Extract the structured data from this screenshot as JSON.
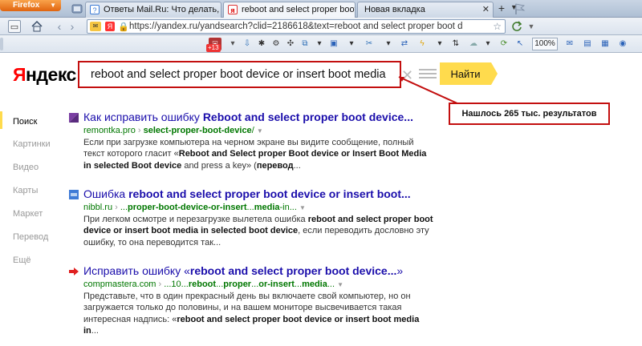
{
  "browser": {
    "app_button": "Firefox",
    "tabs": [
      {
        "title": "Ответы Mail.Ru: Что делать, ес...",
        "favicon": "mailru-answers-icon",
        "active": false
      },
      {
        "title": "reboot and select proper boot device ...",
        "favicon": "yandex-icon",
        "active": true
      },
      {
        "title": "Новая вкладка",
        "favicon": "",
        "active": false
      }
    ],
    "new_tab": "+",
    "url": "https://yandex.ru/yandsearch?clid=2186618&text=reboot and select proper boot d",
    "url_tag": "Я",
    "notification_count": "+13",
    "zoom": "100%"
  },
  "page": {
    "logo_prefix": "Я",
    "logo_rest": "ндекс",
    "query": "reboot and select proper boot device or insert boot media",
    "find_button": "Найти",
    "callout": "Нашлось 265 тыс. результатов",
    "leftnav": [
      "Поиск",
      "Картинки",
      "Видео",
      "Карты",
      "Маркет",
      "Перевод",
      "Ещё"
    ],
    "results": [
      {
        "title_pre": "Как исправить ошибку ",
        "title_bold": "Reboot and select proper boot device...",
        "site": "remontka.pro",
        "sep": " › ",
        "path_bold": "select-proper-boot-device",
        "path_rest": "/",
        "snippet1": "Если при загрузке компьютера на черном экране вы видите сообщение, полный текст которого гласит «",
        "snippet1_b": "Reboot and Select proper Boot device or Insert Boot Media in selected Boot device",
        "snippet1_end": " and press a key» (",
        "snippet1_b2": "перевод",
        "snippet1_tail": "...",
        "favicon_color": "#7b3fa3"
      },
      {
        "title_pre": "Ошибка ",
        "title_bold": "reboot and select proper boot device or insert boot...",
        "site": "nibbl.ru",
        "sep": " › ",
        "path_pre": "...",
        "path_bold": "proper-boot-device-or-insert",
        "path_mid": "...",
        "path_bold2": "media",
        "path_rest": "-in...",
        "snippet_pre": "При легком осмотре и перезагрузке вылетела ошибка ",
        "snippet_b": "reboot and select proper boot device or insert boot media in selected boot device",
        "snippet_end": ", если переводить дословно эту ошибку, то она переводится так...",
        "favicon_color": "#3f7bd6"
      },
      {
        "title_pre": "Исправить ошибку «",
        "title_bold": "reboot and select proper boot device...",
        "title_post": "»",
        "site": "compmastera.com",
        "sep": " › ",
        "path_text": "...10...",
        "path_bold": "reboot",
        "path_2": "...",
        "path_bold2": "proper",
        "path_3": "...",
        "path_bold3": "or-insert",
        "path_4": "...",
        "path_bold4": "media",
        "path_5": "...",
        "snippet_pre": "Представьте, что в один прекрасный день вы включаете свой компьютер, но он загружается только до половины, и на вашем мониторе высвечивается такая интересная надпись: «",
        "snippet_b": "reboot and select proper boot device or insert boot media in",
        "snippet_end": "...",
        "favicon_color": "#e02020"
      }
    ]
  }
}
